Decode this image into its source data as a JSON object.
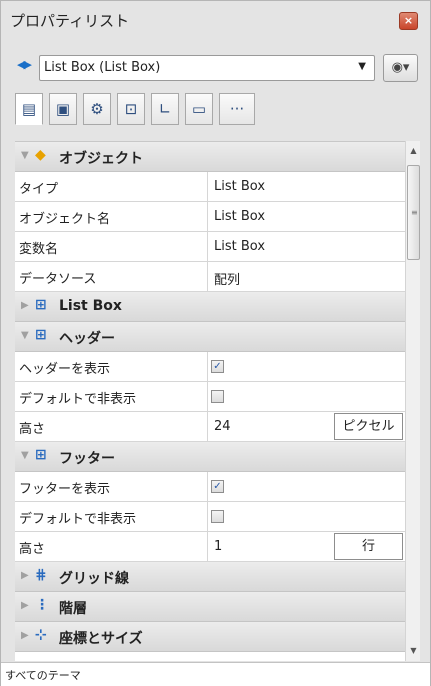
{
  "window": {
    "title": "プロパティリスト",
    "close_glyph": "×"
  },
  "selector": {
    "value": "List Box (List Box)",
    "nav_glyph": "◀▶",
    "chevron_glyph": "▼",
    "eye_glyph": "◉▾"
  },
  "tabs": [
    {
      "name": "tab-list",
      "icon": "list-icon",
      "glyph": "▤"
    },
    {
      "name": "tab-object",
      "icon": "object-icon",
      "glyph": "▣"
    },
    {
      "name": "tab-settings",
      "icon": "gear-icon",
      "glyph": "⚙"
    },
    {
      "name": "tab-layout",
      "icon": "layout-icon",
      "glyph": "⊡"
    },
    {
      "name": "tab-coordinates",
      "icon": "coordinates-icon",
      "glyph": "∟"
    },
    {
      "name": "tab-display",
      "icon": "display-icon",
      "glyph": "▭"
    },
    {
      "name": "tab-more",
      "icon": "more-icon",
      "glyph": "···"
    }
  ],
  "sections": {
    "object": {
      "label": "オブジェクト",
      "icon": "cube-icon",
      "glyph": "◆",
      "tri": "▼"
    },
    "listbox": {
      "label": "List Box",
      "icon": "grid-icon",
      "glyph": "⊞",
      "tri": "▶"
    },
    "header": {
      "label": "ヘッダー",
      "icon": "grid-icon",
      "glyph": "⊞",
      "tri": "▼"
    },
    "footer": {
      "label": "フッター",
      "icon": "grid-icon",
      "glyph": "⊞",
      "tri": "▼"
    },
    "gridlines": {
      "label": "グリッド線",
      "icon": "gridlines-icon",
      "glyph": "⋕",
      "tri": "▶"
    },
    "hierarchy": {
      "label": "階層",
      "icon": "hierarchy-icon",
      "glyph": "⋮",
      "tri": "▶"
    },
    "coordsize": {
      "label": "座標とサイズ",
      "icon": "coords-icon",
      "glyph": "⊹",
      "tri": "▶"
    }
  },
  "object_rows": [
    {
      "name": "タイプ",
      "value": "List Box"
    },
    {
      "name": "オブジェクト名",
      "value": "List Box"
    },
    {
      "name": "変数名",
      "value": "List Box"
    },
    {
      "name": "データソース",
      "value": "配列"
    }
  ],
  "header_rows": {
    "show": {
      "name": "ヘッダーを表示",
      "checked": true,
      "check_glyph": "✓"
    },
    "hide_default": {
      "name": "デフォルトで非表示",
      "checked": false
    },
    "height": {
      "name": "高さ",
      "value": "24",
      "unit": "ピクセル"
    }
  },
  "footer_rows": {
    "show": {
      "name": "フッターを表示",
      "checked": true,
      "check_glyph": "✓"
    },
    "hide_default": {
      "name": "デフォルトで非表示",
      "checked": false
    },
    "height": {
      "name": "高さ",
      "value": "1",
      "unit": "行"
    }
  },
  "scrollbar": {
    "up_glyph": "▲",
    "down_glyph": "▼",
    "grip_glyph": "≡"
  },
  "status": {
    "text": "すべてのテーマ"
  }
}
